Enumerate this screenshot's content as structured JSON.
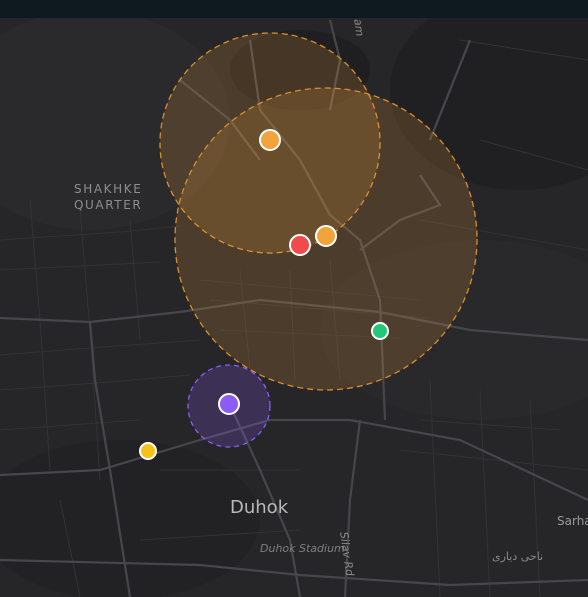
{
  "map": {
    "labels": {
      "district_line1": "SHAKHKE",
      "district_line2": "QUARTER",
      "city": "Duhok",
      "stadium": "Duhok Stadium",
      "road_silav": "Silav Rd",
      "road_top": "am",
      "place_right": "Sarha",
      "arabic_area": "ناحى ديارى"
    },
    "markers": [
      {
        "id": "marker-orange-north",
        "color": "#f2a33c",
        "role": "point"
      },
      {
        "id": "marker-red-center",
        "color": "#ef4b4b",
        "role": "point"
      },
      {
        "id": "marker-orange-center",
        "color": "#f2a33c",
        "role": "point"
      },
      {
        "id": "marker-green-east",
        "color": "#22c77a",
        "role": "point"
      },
      {
        "id": "marker-purple-south",
        "color": "#8b5cf6",
        "role": "point"
      },
      {
        "id": "marker-yellow-west",
        "color": "#f5c21b",
        "role": "point"
      }
    ],
    "radius_circles": [
      {
        "id": "radius-north",
        "color": "#f2a33c"
      },
      {
        "id": "radius-center",
        "color": "#f2a33c"
      },
      {
        "id": "radius-purple",
        "color": "#8b5cf6"
      }
    ],
    "colors": {
      "background": "#262628",
      "roads": "#3a3a3d",
      "major_roads": "#4a4a4e",
      "top_bar": "#0f1a20"
    }
  }
}
